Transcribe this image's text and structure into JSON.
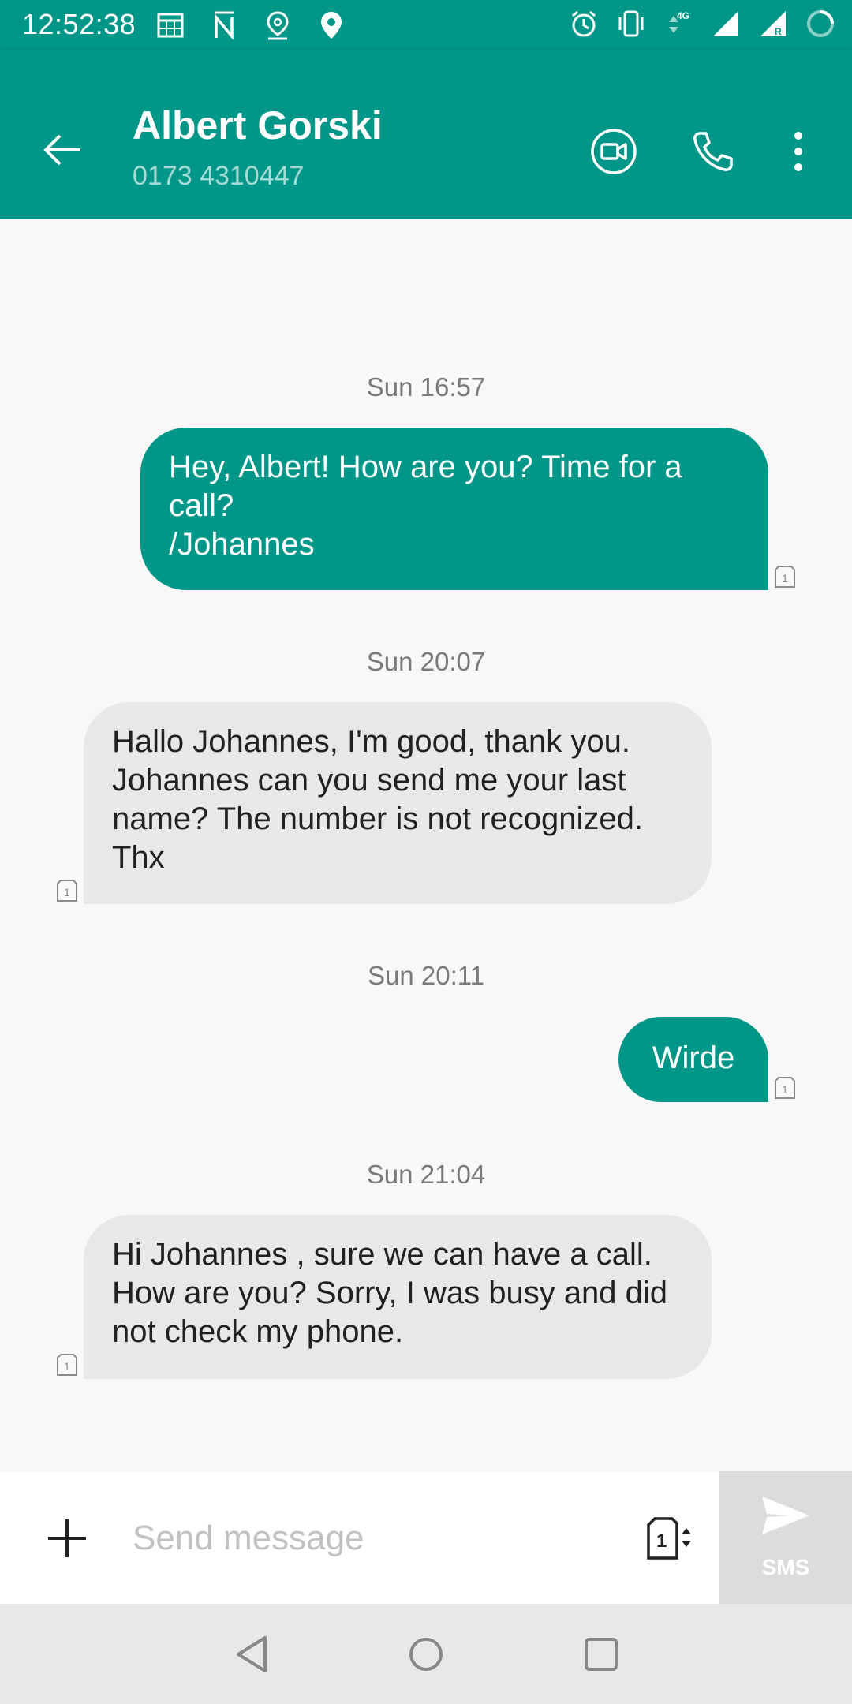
{
  "status_bar": {
    "time": "12:52:38",
    "network_label": "4G",
    "roaming_label": "R",
    "icons_left": [
      "calendar-icon",
      "nfc-icon",
      "location-pin-outline-icon",
      "location-pin-icon"
    ],
    "icons_right": [
      "alarm-icon",
      "vibrate-icon",
      "data-arrows-icon",
      "signal-icon",
      "signal-roaming-icon",
      "battery-saver-icon"
    ]
  },
  "header": {
    "contact_name": "Albert Gorski",
    "contact_number": "0173 4310447",
    "actions": [
      "video-call-icon",
      "phone-call-icon",
      "more-vert-icon"
    ]
  },
  "messages": [
    {
      "timestamp": "Sun 16:57",
      "direction": "outgoing",
      "lines": [
        "Hey, Albert! How are you?  Time for a",
        "call?",
        "/Johannes"
      ],
      "sim": "1"
    },
    {
      "timestamp": "Sun 20:07",
      "direction": "incoming",
      "lines": [
        "Hallo Johannes, I'm good, thank you.",
        "Johannes can you send me your last",
        "name? The number is not recognized.",
        "Thx"
      ],
      "sim": "1"
    },
    {
      "timestamp": "Sun 20:11",
      "direction": "outgoing",
      "lines": [
        "Wirde"
      ],
      "sim": "1"
    },
    {
      "timestamp": "Sun 21:04",
      "direction": "incoming",
      "lines": [
        "Hi Johannes , sure we can have a call.",
        "How are you? Sorry, I was busy and did",
        "not check my phone."
      ],
      "sim": "1"
    }
  ],
  "composer": {
    "placeholder": "Send message",
    "value": "",
    "sim_slot": "1",
    "send_label": "SMS"
  },
  "colors": {
    "primary": "#009688",
    "incoming_bubble": "#e8e8e8",
    "background": "#f8f8f8"
  }
}
